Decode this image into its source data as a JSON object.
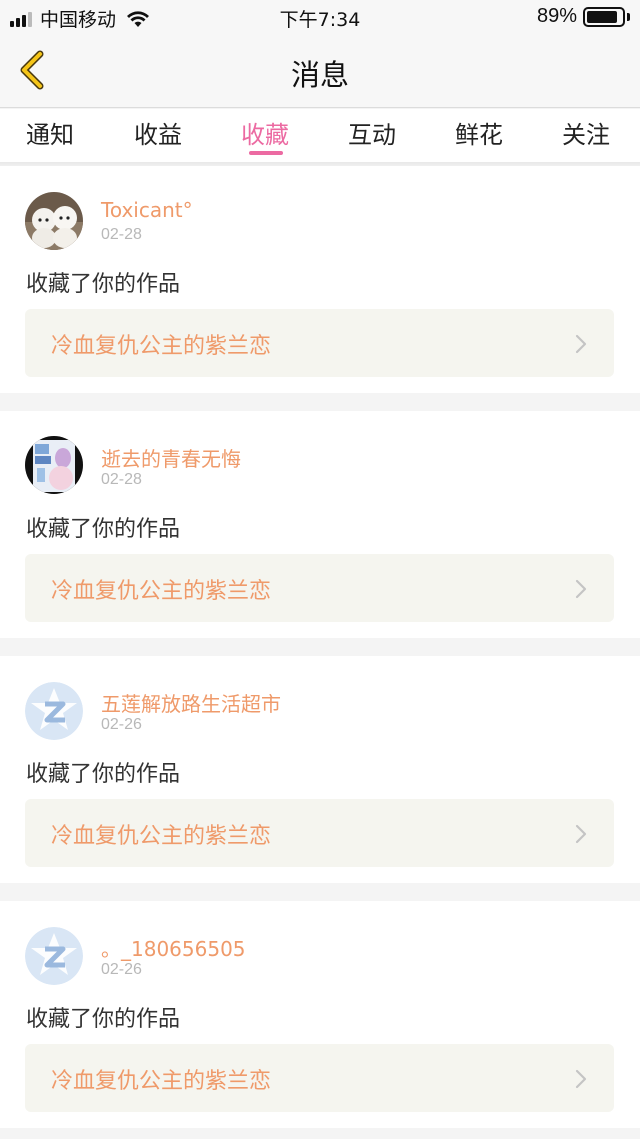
{
  "status_bar": {
    "carrier": "中国移动",
    "time": "下午7:34",
    "battery_percent": "89%",
    "battery_level": 0.89
  },
  "nav": {
    "title": "消息",
    "back_icon": "chevron-left-icon"
  },
  "tabs": [
    {
      "label": "通知",
      "active": false
    },
    {
      "label": "收益",
      "active": false
    },
    {
      "label": "收藏",
      "active": true
    },
    {
      "label": "互动",
      "active": false
    },
    {
      "label": "鲜花",
      "active": false
    },
    {
      "label": "关注",
      "active": false
    }
  ],
  "colors": {
    "accent_pink": "#ec6aa2",
    "username_orange": "#ef9a6a",
    "work_box_bg": "#f5f5ef"
  },
  "items": [
    {
      "username": "Toxicant°",
      "date": "02-28",
      "action": "收藏了你的作品",
      "work_title": "冷血复仇公主的紫兰恋",
      "avatar": "dogs-photo-avatar"
    },
    {
      "username": "逝去的青春无悔",
      "date": "02-28",
      "action": "收藏了你的作品",
      "work_title": "冷血复仇公主的紫兰恋",
      "avatar": "anime-illustration-avatar"
    },
    {
      "username": "五莲解放路生活超市",
      "date": "02-26",
      "action": "收藏了你的作品",
      "work_title": "冷血复仇公主的紫兰恋",
      "avatar": "default-z-avatar"
    },
    {
      "username": "。_180656505",
      "date": "02-26",
      "action": "收藏了你的作品",
      "work_title": "冷血复仇公主的紫兰恋",
      "avatar": "default-z-avatar"
    }
  ]
}
